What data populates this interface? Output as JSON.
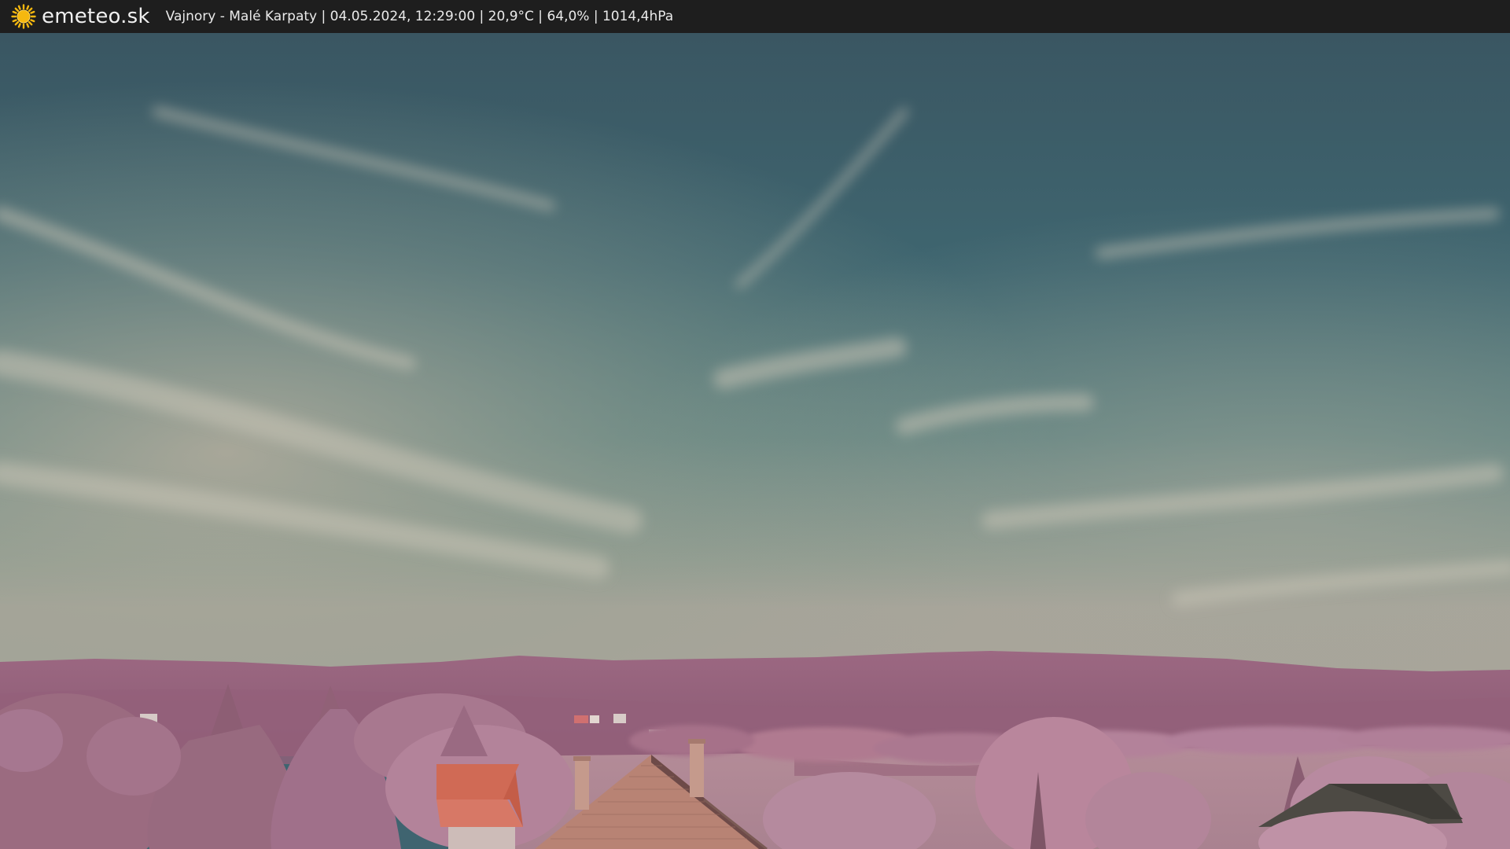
{
  "header": {
    "logo_icon": "sun-icon",
    "site_name": "emeteo.sk",
    "station_info": "Vajnory - Malé Karpaty | 04.05.2024, 12:29:00 | 20,9°C | 64,0% | 1014,4hPa"
  },
  "colors": {
    "topbar_bg": "#1e1e1e",
    "sun": "#f5b80f",
    "sky_top": "#3b5965",
    "sky_mid": "#4a7a7c",
    "sky_horizon": "#9aa39a",
    "hills": "#9c6680",
    "foliage": "#b77c93",
    "roof": "#c55a45"
  }
}
